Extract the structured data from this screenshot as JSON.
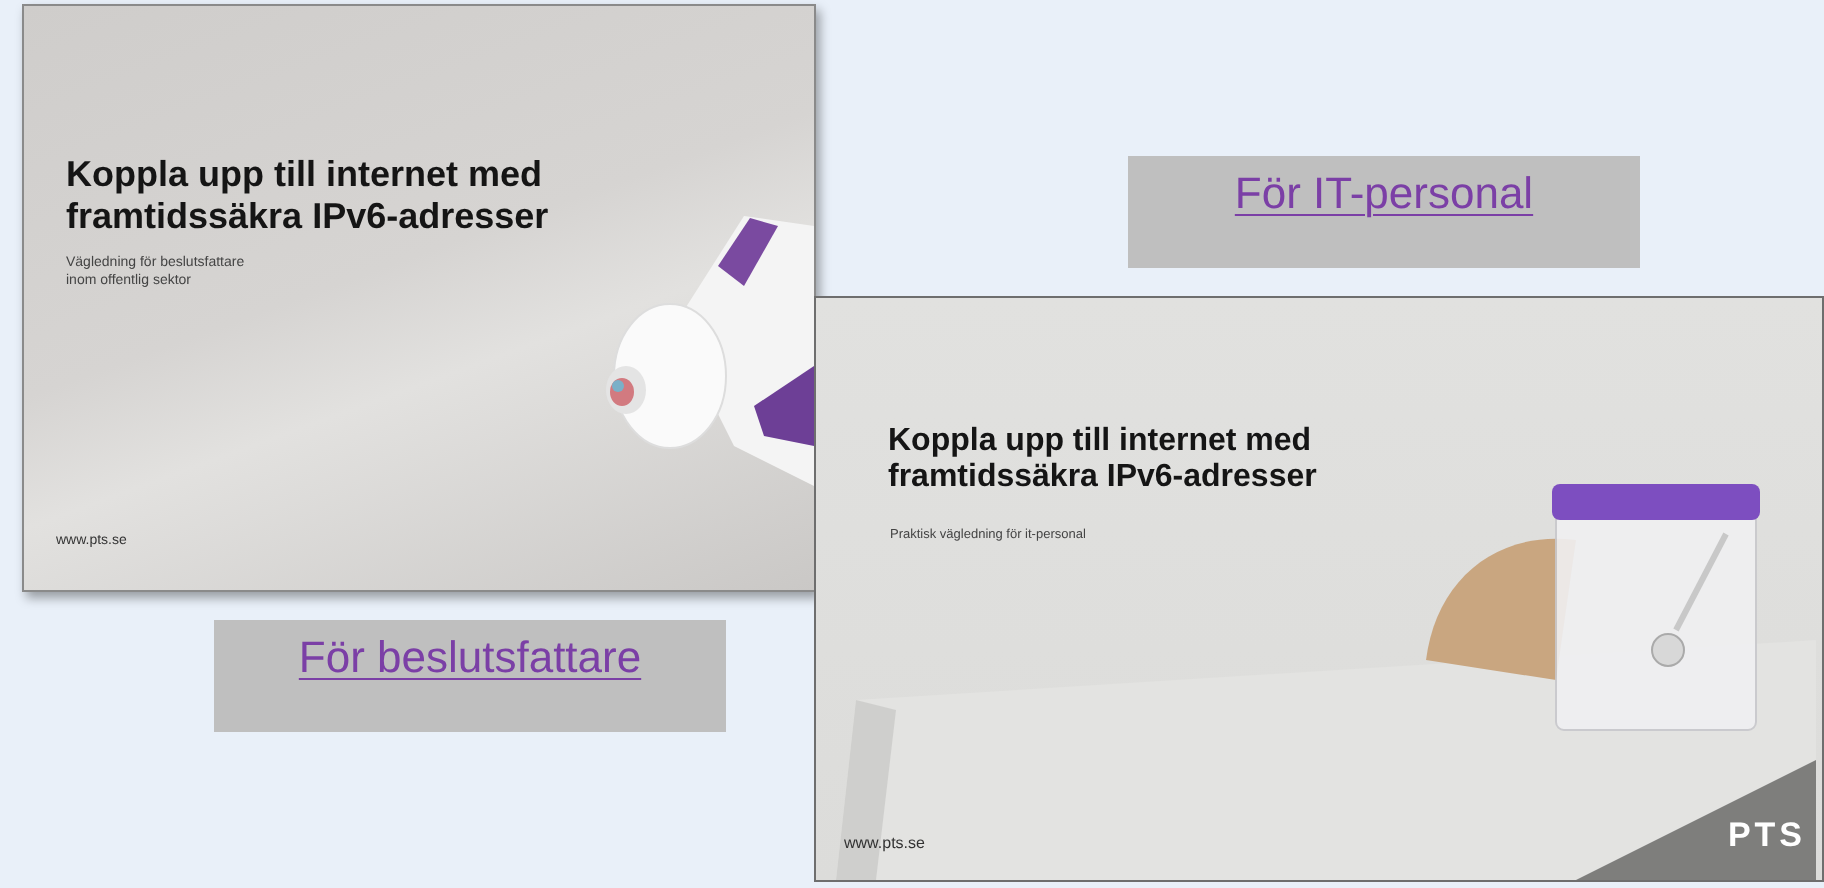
{
  "documents": [
    {
      "kind": "tube",
      "title": "Koppla upp till internet med\nframtidssäkra IPv6-adresser",
      "subtitle": "Vägledning för beslutsfattare\ninom offentlig sektor",
      "url": "www.pts.se",
      "link": "För beslutsfattare"
    },
    {
      "kind": "jar",
      "title": "Koppla upp till internet med\nframtidssäkra IPv6-adresser",
      "subtitle": "Praktisk vägledning för it-personal",
      "url": "www.pts.se",
      "logo": "PTS",
      "link": "För IT-personal"
    }
  ]
}
